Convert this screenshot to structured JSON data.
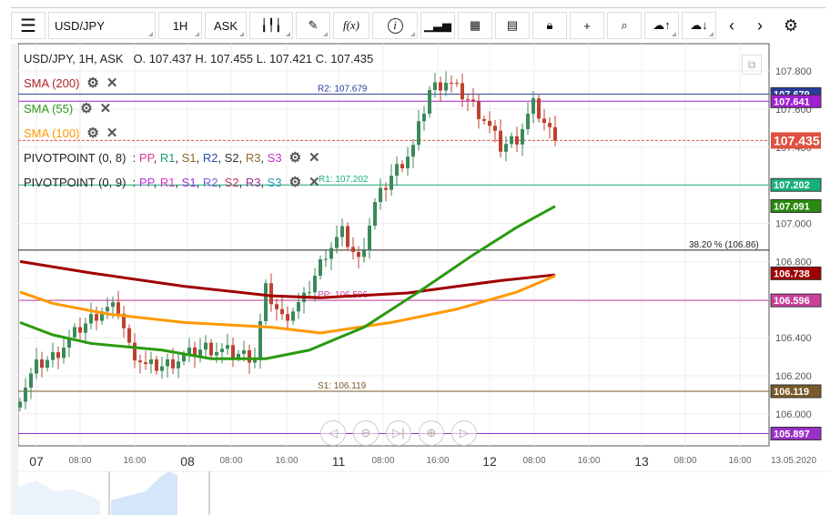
{
  "toolbar": {
    "symbol": "USD/JPY",
    "interval": "1H",
    "price_type": "ASK",
    "fx_label": "f(x)",
    "info_label": "i"
  },
  "legend": {
    "header": "USD/JPY, 1H, ASK",
    "ohlc": "O. 107.437 H. 107.455 L. 107.421 C. 107.435",
    "indicators": [
      {
        "label": "SMA (200)",
        "color": "#b22222"
      },
      {
        "label": "SMA (55)",
        "color": "#2e9a1a"
      },
      {
        "label": "SMA (100)",
        "color": "#ff9900"
      }
    ],
    "pivots": [
      {
        "label": "PIVOTPOINT (0, 8)",
        "parts": [
          {
            "t": "PP",
            "c": "#d63c8f"
          },
          {
            "t": "R1",
            "c": "#1aa070"
          },
          {
            "t": "S1",
            "c": "#8a6a2a"
          },
          {
            "t": "R2",
            "c": "#2a4aa8"
          },
          {
            "t": "S2",
            "c": "#333333"
          },
          {
            "t": "R3",
            "c": "#8a6a2a"
          },
          {
            "t": "S3",
            "c": "#c030c0"
          }
        ]
      },
      {
        "label": "PIVOTPOINT (0, 9)",
        "parts": [
          {
            "t": "PP",
            "c": "#c030e0"
          },
          {
            "t": "R1",
            "c": "#e030c0"
          },
          {
            "t": "S1",
            "c": "#a030e0"
          },
          {
            "t": "R2",
            "c": "#7a60e0"
          },
          {
            "t": "S2",
            "c": "#c0306a"
          },
          {
            "t": "R3",
            "c": "#a03090"
          },
          {
            "t": "S3",
            "c": "#2a9ab0"
          }
        ]
      }
    ]
  },
  "price_axis": {
    "ticks": [
      107.8,
      107.6,
      107.4,
      107.2,
      107.0,
      106.8,
      106.6,
      106.4,
      106.2,
      106.0
    ],
    "min": 105.82,
    "max": 107.94
  },
  "levels": [
    {
      "value": 107.679,
      "label": "R2: 107.679",
      "badge": "107.679",
      "color": "#2a3c9a"
    },
    {
      "value": 107.641,
      "badge": "107.641",
      "color": "#a020d0"
    },
    {
      "value": 107.435,
      "badge": "107.435",
      "color": "#e05040",
      "dashed": true
    },
    {
      "value": 107.202,
      "label": "R1: 107.202",
      "badge": "107.202",
      "color": "#1ab07a"
    },
    {
      "value": 106.86,
      "label": "38.20 % (106.86)",
      "color": "#222222"
    },
    {
      "value": 106.596,
      "label": "PP: 106.596",
      "badge": "106.596",
      "color": "#c8409a"
    },
    {
      "value": 106.119,
      "label": "S1: 106.119",
      "badge": "106.119",
      "color": "#7a5a2a"
    },
    {
      "value": 105.897,
      "badge": "105.897",
      "color": "#9a30c8"
    }
  ],
  "sma_badges": [
    {
      "value": 107.091,
      "badge": "107.091",
      "color": "#2a8a10"
    },
    {
      "value": 106.738,
      "badge": "106.738",
      "color": "#a00000"
    }
  ],
  "candles_keypoints": [
    [
      0,
      106.1
    ],
    [
      3,
      106.25
    ],
    [
      6,
      106.3
    ],
    [
      11,
      106.45
    ],
    [
      15,
      106.55
    ],
    [
      18,
      106.55
    ],
    [
      20,
      106.35
    ],
    [
      23,
      106.25
    ],
    [
      26,
      106.25
    ],
    [
      30,
      106.3
    ],
    [
      34,
      106.35
    ],
    [
      37,
      106.33
    ],
    [
      43,
      106.3
    ],
    [
      45,
      106.65
    ],
    [
      48,
      106.5
    ],
    [
      52,
      106.6
    ],
    [
      56,
      106.85
    ],
    [
      59,
      106.95
    ],
    [
      62,
      106.8
    ],
    [
      65,
      107.1
    ],
    [
      68,
      107.25
    ],
    [
      72,
      107.4
    ],
    [
      75,
      107.7
    ],
    [
      78,
      107.75
    ],
    [
      82,
      107.65
    ],
    [
      85,
      107.55
    ],
    [
      88,
      107.4
    ],
    [
      91,
      107.45
    ],
    [
      94,
      107.62
    ],
    [
      98,
      107.435
    ]
  ],
  "sma": [
    {
      "name": "SMA 200",
      "color": "#a00000",
      "points": [
        [
          0,
          106.8
        ],
        [
          13,
          106.74
        ],
        [
          30,
          106.67
        ],
        [
          46,
          106.62
        ],
        [
          55,
          106.61
        ],
        [
          71,
          106.635
        ],
        [
          88,
          106.7
        ],
        [
          98,
          106.73
        ]
      ]
    },
    {
      "name": "SMA 100",
      "color": "#ff9900",
      "points": [
        [
          0,
          106.64
        ],
        [
          6,
          106.58
        ],
        [
          16,
          106.525
        ],
        [
          30,
          106.48
        ],
        [
          46,
          106.455
        ],
        [
          55,
          106.425
        ],
        [
          68,
          106.48
        ],
        [
          80,
          106.55
        ],
        [
          91,
          106.64
        ],
        [
          98,
          106.725
        ]
      ]
    },
    {
      "name": "SMA 55",
      "color": "#2a9a10",
      "points": [
        [
          0,
          106.48
        ],
        [
          6,
          106.415
        ],
        [
          13,
          106.37
        ],
        [
          26,
          106.335
        ],
        [
          35,
          106.29
        ],
        [
          45,
          106.29
        ],
        [
          53,
          106.335
        ],
        [
          63,
          106.455
        ],
        [
          73,
          106.64
        ],
        [
          83,
          106.835
        ],
        [
          91,
          106.98
        ],
        [
          98,
          107.09
        ]
      ]
    }
  ],
  "time_axis": [
    {
      "t": "07",
      "day": true
    },
    {
      "t": "08:00"
    },
    {
      "t": "16:00"
    },
    {
      "t": "08",
      "day": true
    },
    {
      "t": "08:00"
    },
    {
      "t": "16:00"
    },
    {
      "t": "11",
      "day": true
    },
    {
      "t": "08:00"
    },
    {
      "t": "16:00"
    },
    {
      "t": "12",
      "day": true
    },
    {
      "t": "08:00"
    },
    {
      "t": "16:00"
    },
    {
      "t": "13",
      "day": true
    },
    {
      "t": "08:00"
    },
    {
      "t": "16:00"
    },
    {
      "t": "13.05.2020"
    }
  ],
  "nav_buttons": [
    "◁",
    "⊖",
    "▷|",
    "⊕",
    "▷"
  ],
  "colors": {
    "up": "#3a8a5a",
    "down": "#c04030"
  }
}
